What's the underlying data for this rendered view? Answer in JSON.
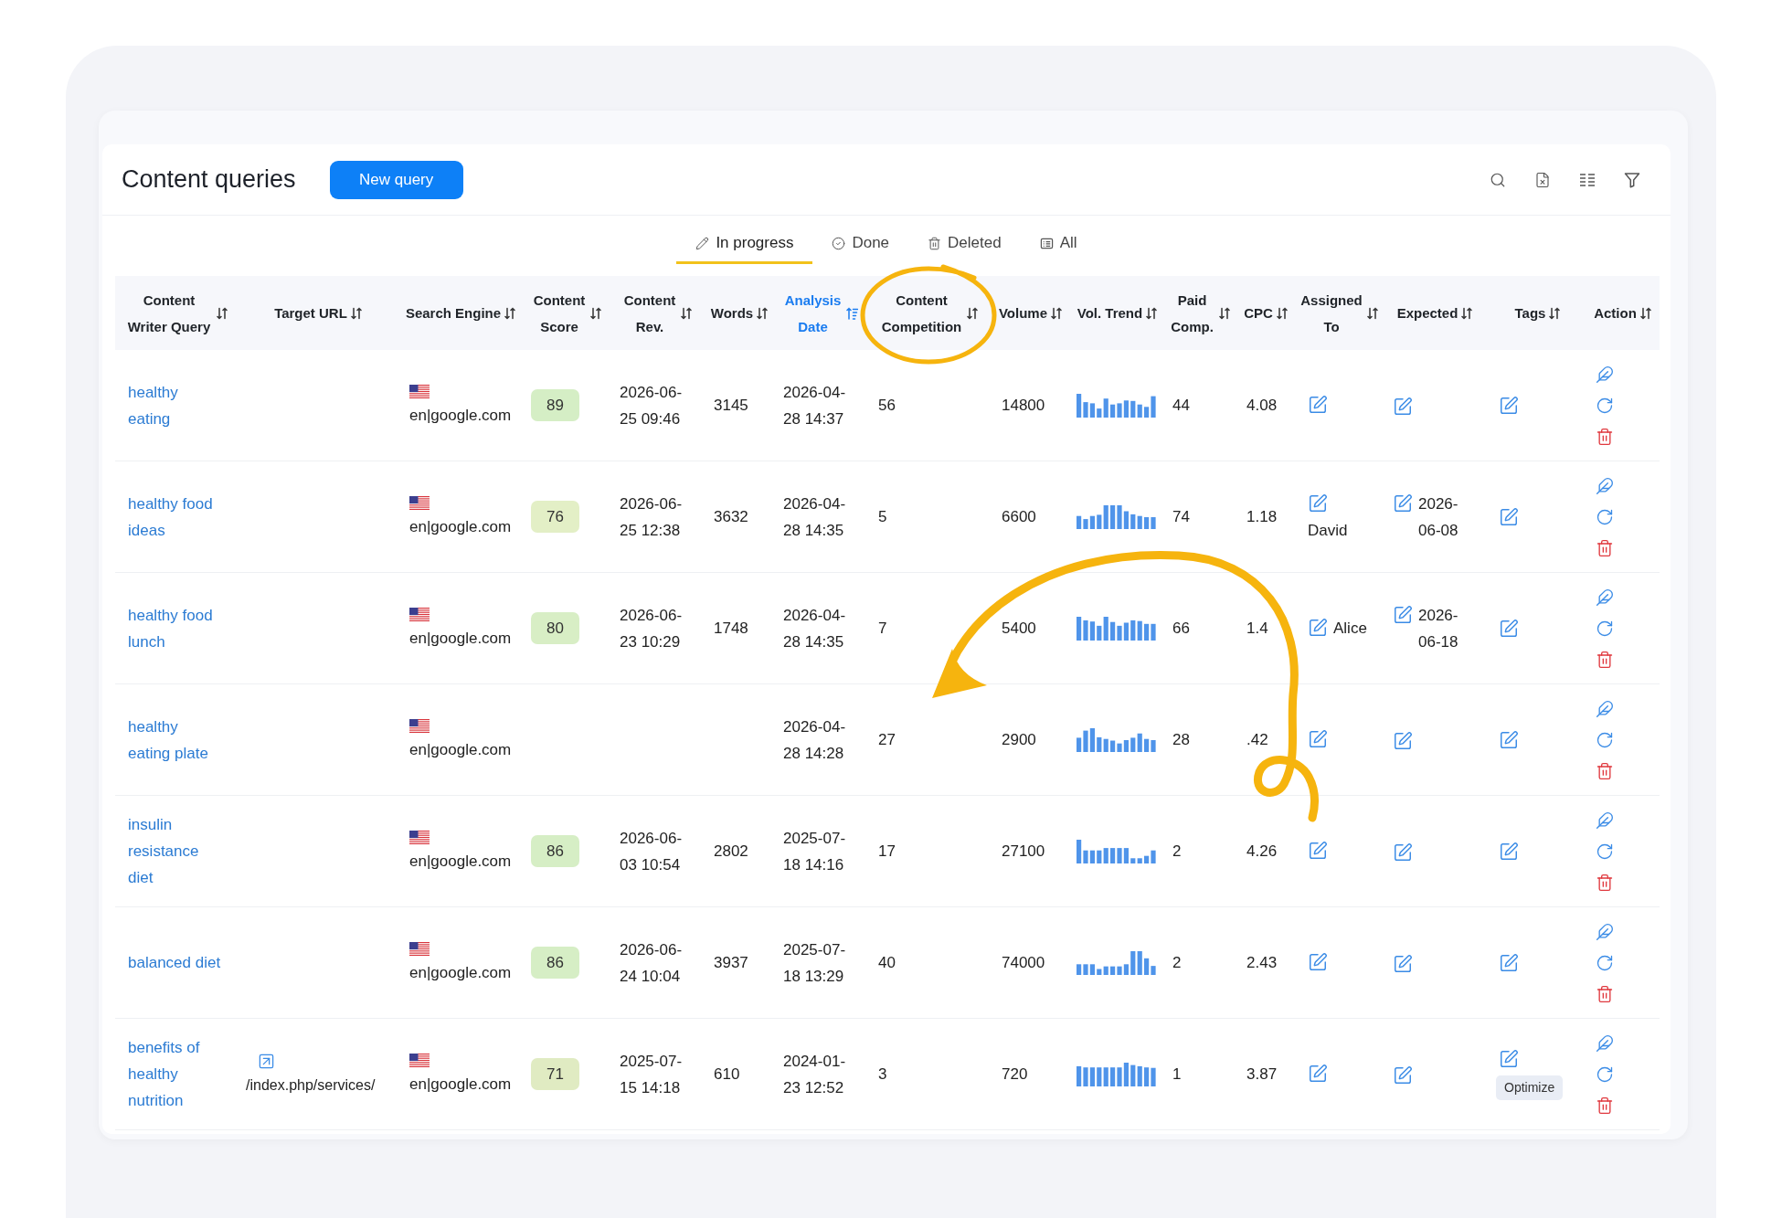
{
  "title": "Content queries",
  "new_query_button": "New query",
  "tabs": [
    {
      "label": "In progress",
      "selected": true
    },
    {
      "label": "Done",
      "selected": false
    },
    {
      "label": "Deleted",
      "selected": false
    },
    {
      "label": "All",
      "selected": false
    }
  ],
  "table": {
    "columns": [
      {
        "label": "Content Writer Query",
        "sorted": false
      },
      {
        "label": "Target URL",
        "sorted": false
      },
      {
        "label": "Search Engine",
        "sorted": false
      },
      {
        "label": "Content Score",
        "sorted": false
      },
      {
        "label": "Content Rev.",
        "sorted": false
      },
      {
        "label": "Words",
        "sorted": false
      },
      {
        "label": "Analysis Date",
        "sorted": true
      },
      {
        "label": "Content Competition",
        "sorted": false
      },
      {
        "label": "Volume",
        "sorted": false
      },
      {
        "label": "Vol. Trend",
        "sorted": false
      },
      {
        "label": "Paid Comp.",
        "sorted": false
      },
      {
        "label": "CPC",
        "sorted": false
      },
      {
        "label": "Assigned To",
        "sorted": false
      },
      {
        "label": "Expected",
        "sorted": false
      },
      {
        "label": "Tags",
        "sorted": false
      },
      {
        "label": "Action",
        "sorted": false
      }
    ],
    "rows": [
      {
        "query": "healthy eating",
        "search_engine": "en|google.com",
        "score": {
          "value": "89",
          "color": "#d5eec5"
        },
        "content_rev": "2026-06-25 09:46",
        "words": "3145",
        "analysis_date": "2026-04-28 14:37",
        "competition": "56",
        "volume": "14800",
        "paid_comp": "44",
        "cpc": "4.08"
      },
      {
        "query": "healthy food ideas",
        "search_engine": "en|google.com",
        "score": {
          "value": "76",
          "color": "#e3efc6"
        },
        "content_rev": "2026-06-25 12:38",
        "words": "3632",
        "analysis_date": "2026-04-28 14:35",
        "competition": "5",
        "volume": "6600",
        "paid_comp": "74",
        "cpc": "1.18",
        "assigned_to": "David",
        "expected": "2026-06-08"
      },
      {
        "query": "healthy food lunch",
        "search_engine": "en|google.com",
        "score": {
          "value": "80",
          "color": "#d8eec5"
        },
        "content_rev": "2026-06-23 10:29",
        "words": "1748",
        "analysis_date": "2026-04-28 14:35",
        "competition": "7",
        "volume": "5400",
        "paid_comp": "66",
        "cpc": "1.4",
        "assigned_to": "Alice",
        "expected": "2026-06-18"
      },
      {
        "query": "healthy eating plate",
        "search_engine": "en|google.com",
        "analysis_date": "2026-04-28 14:28",
        "competition": "27",
        "volume": "2900",
        "paid_comp": "28",
        "cpc": ".42"
      },
      {
        "query": "insulin resistance diet",
        "search_engine": "en|google.com",
        "score": {
          "value": "86",
          "color": "#d6eec5"
        },
        "content_rev": "2026-06-03 10:54",
        "words": "2802",
        "analysis_date": "2025-07-18 14:16",
        "competition": "17",
        "volume": "27100",
        "paid_comp": "2",
        "cpc": "4.26"
      },
      {
        "query": "balanced diet",
        "search_engine": "en|google.com",
        "score": {
          "value": "86",
          "color": "#d6eec5"
        },
        "content_rev": "2026-06-24 10:04",
        "words": "3937",
        "analysis_date": "2025-07-18 13:29",
        "competition": "40",
        "volume": "74000",
        "paid_comp": "2",
        "cpc": "2.43"
      },
      {
        "query": "benefits of healthy nutrition",
        "target_url": "/index.php/services/",
        "search_engine": "en|google.com",
        "score": {
          "value": "71",
          "color": "#e0ebc2"
        },
        "content_rev": "2025-07-15 14:18",
        "words": "610",
        "analysis_date": "2024-01-23 12:52",
        "competition": "3",
        "volume": "720",
        "paid_comp": "1",
        "cpc": "3.87",
        "tags_tooltip": "Optimize"
      }
    ]
  }
}
